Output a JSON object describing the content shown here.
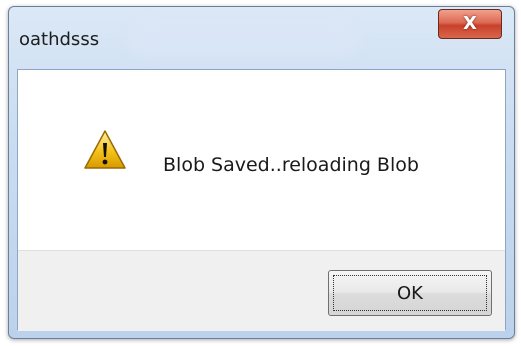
{
  "dialog": {
    "title": "oathdsss",
    "close_label": "X",
    "message": "Blob Saved..reloading Blob",
    "ok_label": "OK",
    "icon": "warning-icon"
  },
  "colors": {
    "titlebar": "#c9dcf1",
    "close_button": "#d8674c",
    "warning_yellow": "#f4c21b"
  }
}
